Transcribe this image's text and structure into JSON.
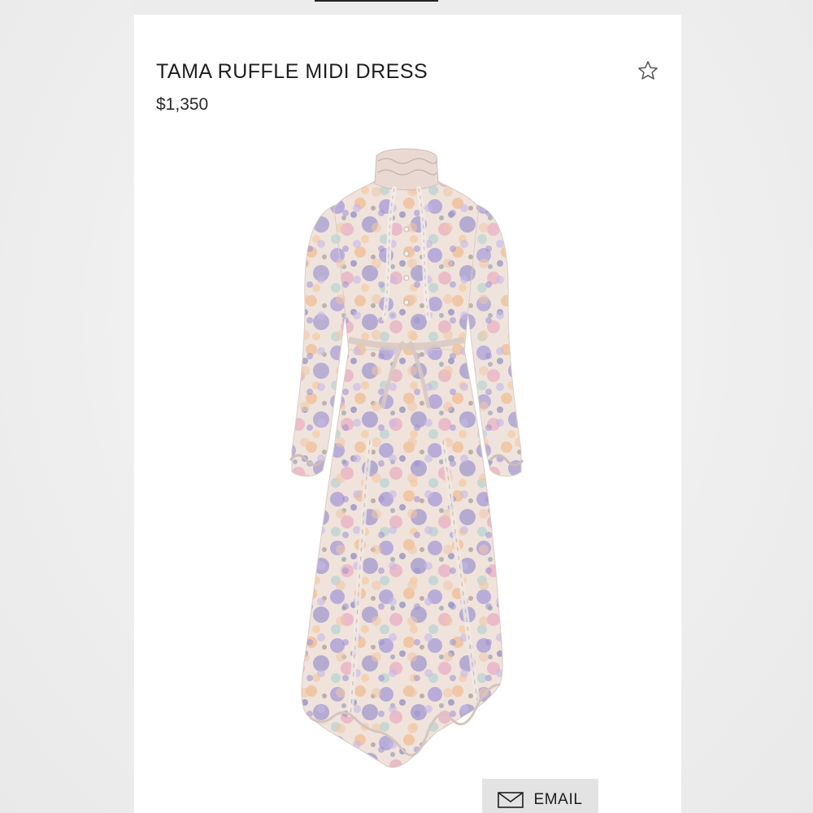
{
  "product": {
    "title": "TAMA RUFFLE MIDI DRESS",
    "price": "$1,350",
    "favorite_icon": "star-outline-icon",
    "image_alt": "Floral ruffle midi dress with long sleeves and high neck"
  },
  "actions": {
    "email_label": "EMAIL",
    "email_icon": "envelope-icon"
  },
  "colors": {
    "card_background": "#ffffff",
    "page_background": "#f3f3f3",
    "top_strip": "#ececec",
    "button_background": "#e3e3e3",
    "text": "#1e1e1e"
  }
}
